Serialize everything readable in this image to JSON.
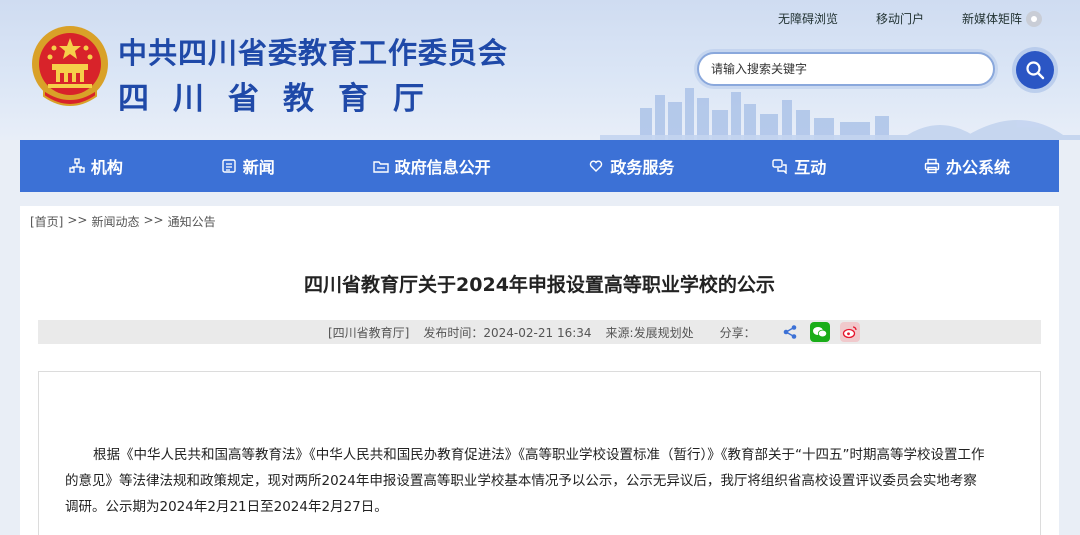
{
  "header": {
    "title_line1": "中共四川省委教育工作委员会",
    "title_line2": "四川省教育厅",
    "top_links": [
      "无障碍浏览",
      "移动门户",
      "新媒体矩阵"
    ],
    "search_placeholder": "请输入搜索关键字"
  },
  "nav": {
    "items": [
      "机构",
      "新闻",
      "政府信息公开",
      "政务服务",
      "互动",
      "办公系统"
    ]
  },
  "breadcrumb": {
    "home": "[首页]",
    "sep": ">>",
    "level1": "新闻动态",
    "level2": "通知公告"
  },
  "article": {
    "title": "四川省教育厅关于2024年申报设置高等职业学校的公示",
    "source": "[四川省教育厅]",
    "publish_label": "发布时间：",
    "publish_time": "2024-02-21 16:34",
    "origin": "来源:发展规划处",
    "share_label": "分享：",
    "paragraph": "根据《中华人民共和国高等教育法》《中华人民共和国民办教育促进法》《高等职业学校设置标准（暂行）》《教育部关于“十四五”时期高等学校设置工作的意见》等法律法规和政策规定，现对两所2024年申报设置高等职业学校基本情况予以公示，公示无异议后，我厅将组织省高校设置评议委员会实地考察调研。公示期为2024年2月21日至2024年2月27日。"
  },
  "colors": {
    "brand_blue": "#1f49a8",
    "nav_blue": "#3c71d6",
    "wechat_green": "#1aad19",
    "weibo_red": "#e6162d"
  }
}
